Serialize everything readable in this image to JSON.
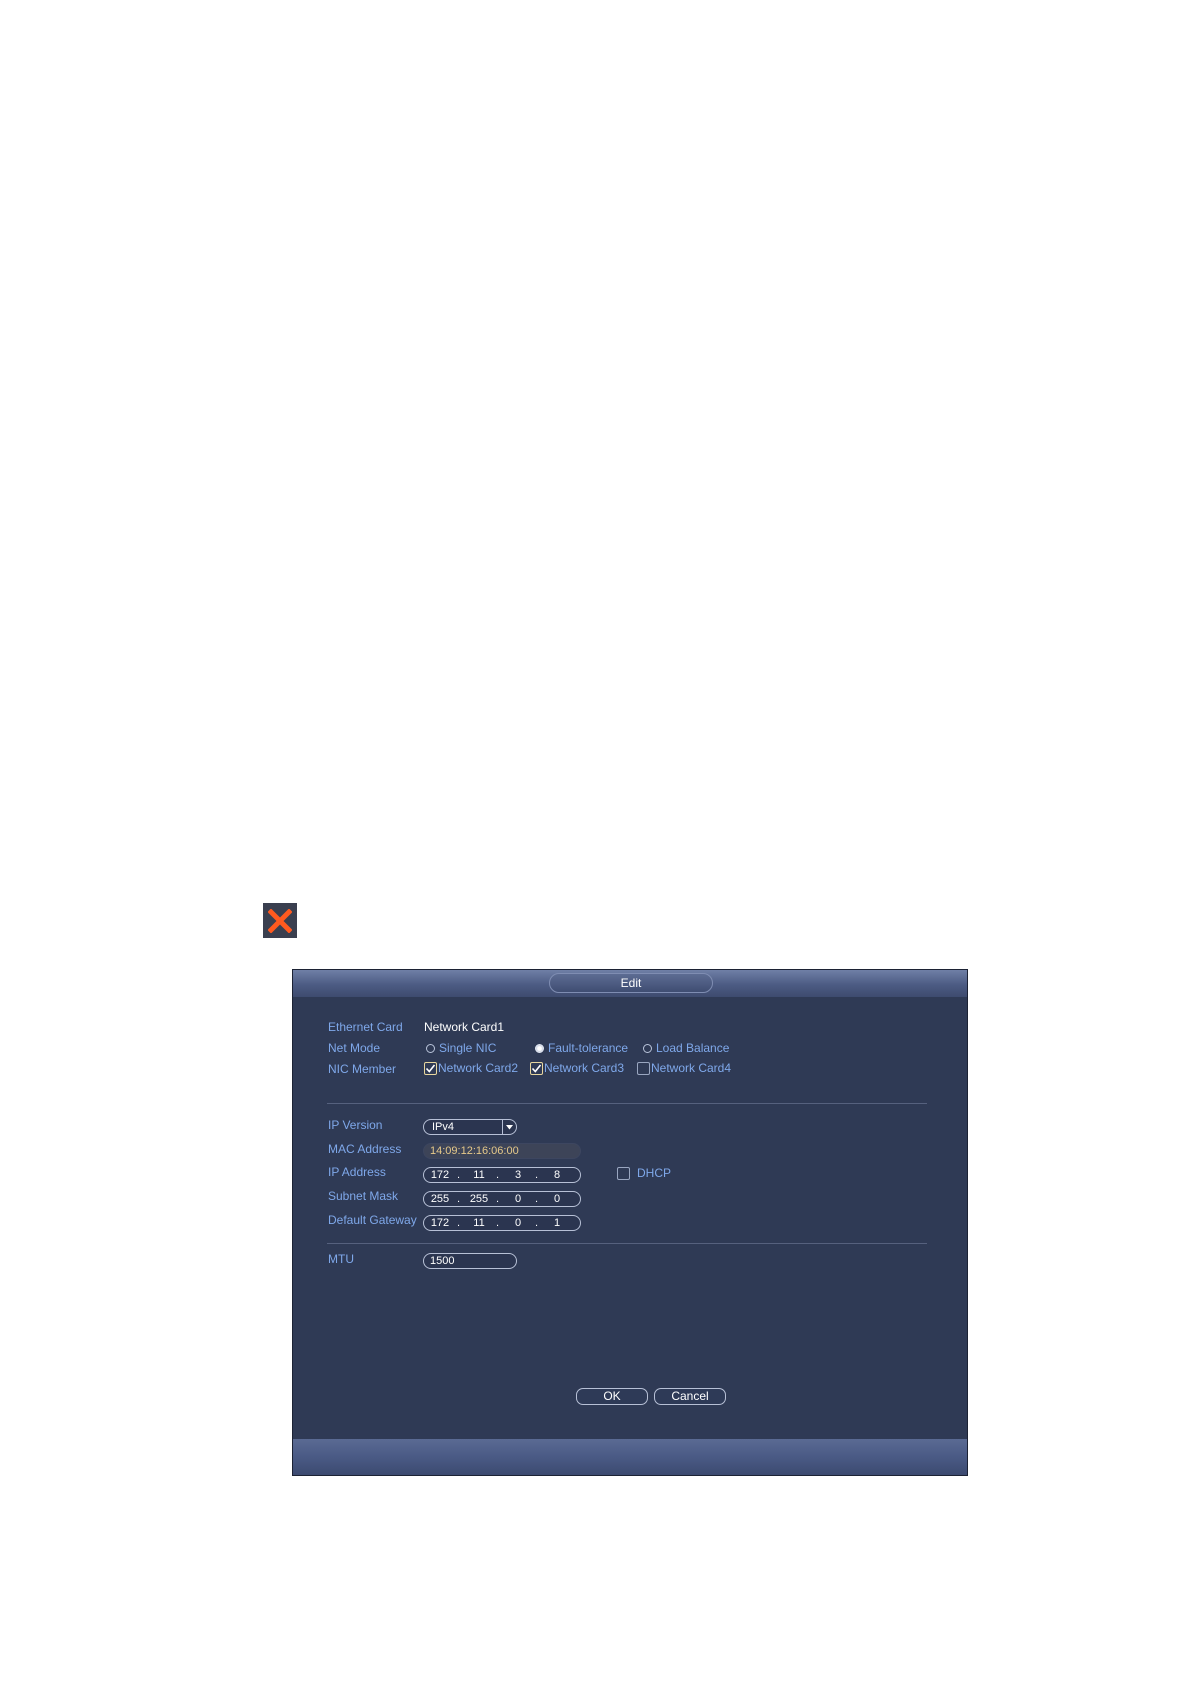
{
  "dialog": {
    "title": "Edit",
    "ethernet_card": {
      "label": "Ethernet Card",
      "value": "Network Card1"
    },
    "net_mode": {
      "label": "Net Mode",
      "options": [
        {
          "label": "Single NIC",
          "selected": false
        },
        {
          "label": "Fault-tolerance",
          "selected": true
        },
        {
          "label": "Load Balance",
          "selected": false
        }
      ]
    },
    "nic_member": {
      "label": "NIC Member",
      "members": [
        {
          "label": "Network Card2",
          "checked": true
        },
        {
          "label": "Network Card3",
          "checked": true
        },
        {
          "label": "Network Card4",
          "checked": false
        }
      ]
    },
    "ip_version": {
      "label": "IP Version",
      "value": "IPv4"
    },
    "mac_address": {
      "label": "MAC Address",
      "value": "14:09:12:16:06:00"
    },
    "ip_address": {
      "label": "IP Address",
      "octets": [
        "172",
        "11",
        "3",
        "8"
      ]
    },
    "dhcp": {
      "label": "DHCP",
      "checked": false
    },
    "subnet_mask": {
      "label": "Subnet Mask",
      "octets": [
        "255",
        "255",
        "0",
        "0"
      ]
    },
    "default_gateway": {
      "label": "Default Gateway",
      "octets": [
        "172",
        "11",
        "0",
        "1"
      ]
    },
    "mtu": {
      "label": "MTU",
      "value": "1500"
    },
    "ok_label": "OK",
    "cancel_label": "Cancel"
  },
  "colors": {
    "dialog_bg": "#2f3a55",
    "label_blue": "#7fa8ea",
    "close_icon": "#ff5a1f"
  }
}
